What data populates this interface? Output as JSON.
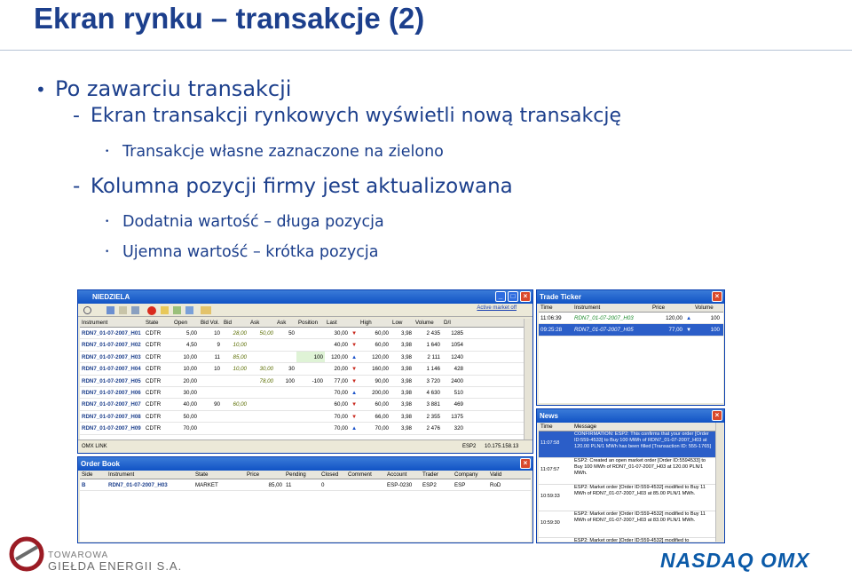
{
  "slide": {
    "title": "Ekran rynku – transakcje (2)"
  },
  "bullets": {
    "b1": "Po zawarciu transakcji",
    "b1_marker": "•",
    "dash": "-",
    "dot": "•",
    "b1a": "Ekran transakcji rynkowych wyświetli nową transakcję",
    "b1a1": "Transakcje własne zaznaczone na zielono",
    "b1b": "Kolumna pozycji firmy jest aktualizowana",
    "b1b1": "Dodatnia wartość – długa pozycja",
    "b1b2": "Ujemna wartość – krótka pozycja"
  },
  "market": {
    "title": "NIEDZIELA",
    "toolbar_link": "Active market off",
    "headers": [
      "Instrument",
      "State",
      "Open",
      "Bid Vol.",
      "Bid",
      "Ask",
      "Ask",
      "Position",
      "Last",
      "",
      "High",
      "Low",
      "Volume",
      "D/I"
    ],
    "rows": [
      [
        "RDN7_01-07-2007_H01",
        "CDTR",
        "5,00",
        "10",
        "28,00",
        "50,00",
        "50",
        "",
        "30,00",
        "▼",
        "60,00",
        "3,98",
        "2 435",
        "1285"
      ],
      [
        "RDN7_01-07-2007_H02",
        "CDTR",
        "4,50",
        "9",
        "10,00",
        "",
        "",
        "",
        "40,00",
        "▼",
        "60,00",
        "3,98",
        "1 640",
        "1054"
      ],
      [
        "RDN7_01-07-2007_H03",
        "CDTR",
        "10,00",
        "11",
        "85,00",
        "",
        "",
        "100",
        "120,00",
        "▲",
        "120,00",
        "3,98",
        "2 111",
        "1240"
      ],
      [
        "RDN7_01-07-2007_H04",
        "CDTR",
        "10,00",
        "10",
        "10,00",
        "30,00",
        "30",
        "",
        "20,00",
        "▼",
        "160,00",
        "3,98",
        "1 146",
        "428"
      ],
      [
        "RDN7_01-07-2007_H05",
        "CDTR",
        "20,00",
        "",
        "",
        "78,00",
        "100",
        "-100",
        "77,00",
        "▼",
        "90,00",
        "3,98",
        "3 720",
        "2400"
      ],
      [
        "RDN7_01-07-2007_H06",
        "CDTR",
        "30,00",
        "",
        "",
        "",
        "",
        "",
        "70,00",
        "▲",
        "200,00",
        "3,98",
        "4 630",
        "510"
      ],
      [
        "RDN7_01-07-2007_H07",
        "CDTR",
        "40,00",
        "90",
        "60,00",
        "",
        "",
        "",
        "60,00",
        "▼",
        "60,00",
        "3,98",
        "3 881",
        "469"
      ],
      [
        "RDN7_01-07-2007_H08",
        "CDTR",
        "50,00",
        "",
        "",
        "",
        "",
        "",
        "70,00",
        "▼",
        "66,00",
        "3,98",
        "2 355",
        "1375"
      ],
      [
        "RDN7_01-07-2007_H09",
        "CDTR",
        "70,00",
        "",
        "",
        "",
        "",
        "",
        "70,00",
        "▲",
        "70,00",
        "3,98",
        "2 476",
        "320"
      ]
    ],
    "status_left": "OMX LINK",
    "status_mid": "ESP2",
    "status_ip": "10.175.158.13"
  },
  "order_book": {
    "title": "Order Book",
    "headers": [
      "Side",
      "Instrument",
      "State",
      "Price",
      "Pending",
      "Closed",
      "Comment",
      "Account",
      "Trader",
      "Company",
      "Valid"
    ],
    "row": [
      "B",
      "RDN7_01-07-2007_H03",
      "MARKET",
      "85,00",
      "11",
      "0",
      "",
      "ESP-0230",
      "ESP2",
      "ESP",
      "RoD"
    ]
  },
  "ticker": {
    "title": "Trade Ticker",
    "headers": [
      "Time",
      "Instrument",
      "Price",
      "Volume"
    ],
    "rows": [
      [
        "11:06:39",
        "RDN7_01-07-2007_H03",
        "120,00",
        "▲",
        "100"
      ],
      [
        "09:25:28",
        "RDN7_01-07-2007_H05",
        "77,00",
        "▼",
        "100"
      ]
    ]
  },
  "news": {
    "title": "News",
    "headers": [
      "Time",
      "Message"
    ],
    "rows": [
      [
        "11:07:58",
        "CONFIRMATION: ESP2: This confirms that your order [Order ID:559-4533] to Buy 100 MWh of RDN7_01-07-2007_H03 at 120.00 PLN/1 MWh has been filled [Transaction ID: 555-1765]"
      ],
      [
        "11:07:57",
        "ESP2: Created an open market order [Order ID:5594533] to Buy 100 MWh of RDN7_01-07-2007_H03 at 120.00 PLN/1 MWh."
      ],
      [
        "10:59:33",
        "ESP2: Market order [Order ID:559-4532] modified to Buy 11 MWh of RDN7_01-07-2007_H03 at 85.00 PLN/1 MWh."
      ],
      [
        "10:59:30",
        "ESP2: Market order [Order ID:559-4532] modified to Buy 11 MWh of RDN7_01-07-2007_H03 at 83.00 PLN/1 MWh."
      ],
      [
        "",
        "ESP2: Market order [Order ID:559-4532] modified to"
      ]
    ]
  },
  "logos": {
    "tge_line1": "TOWAROWA",
    "tge_line2": "GIEŁDA ENERGII S.A.",
    "nasdaq": "NASDAQ OMX"
  },
  "colors": {
    "heading": "#1c3f8c",
    "titlebar": "#1153c5",
    "own_trade": "#dff3d6"
  }
}
